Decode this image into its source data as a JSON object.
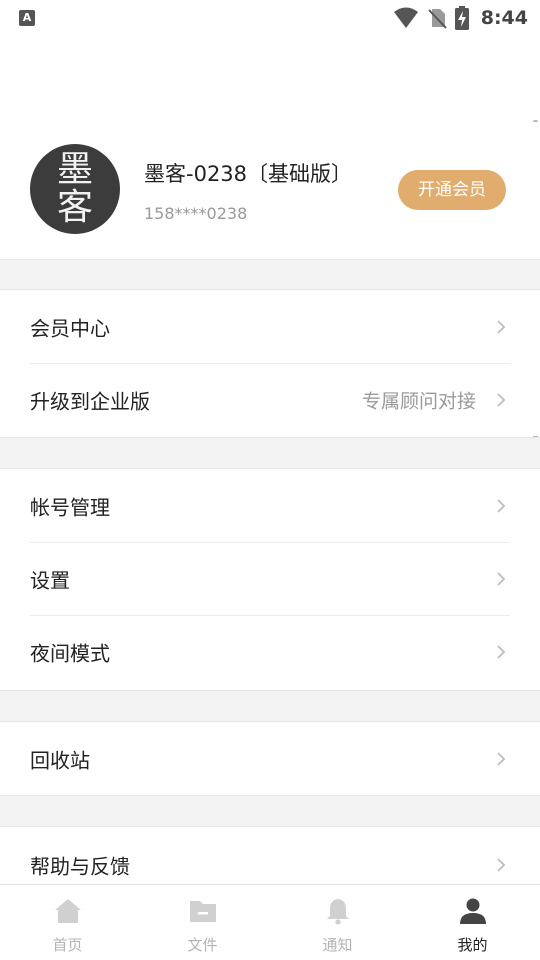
{
  "status_bar": {
    "app_icon_letter": "A",
    "time": "8:44"
  },
  "profile": {
    "avatar_chars": [
      "墨",
      "客"
    ],
    "name": "墨客-0238〔基础版〕",
    "phone": "158****0238",
    "member_button_label": "开通会员",
    "accent_color": "#e0ad6e"
  },
  "menu_groups": [
    [
      {
        "label": "会员中心",
        "value": ""
      },
      {
        "label": "升级到企业版",
        "value": "专属顾问对接"
      }
    ],
    [
      {
        "label": "帐号管理",
        "value": ""
      },
      {
        "label": "设置",
        "value": ""
      },
      {
        "label": "夜间模式",
        "value": ""
      }
    ],
    [
      {
        "label": "回收站",
        "value": ""
      }
    ],
    [
      {
        "label": "帮助与反馈",
        "value": ""
      }
    ]
  ],
  "tab_bar": {
    "tabs": [
      {
        "label": "首页",
        "icon": "home-icon"
      },
      {
        "label": "文件",
        "icon": "folder-icon"
      },
      {
        "label": "通知",
        "icon": "bell-icon"
      },
      {
        "label": "我的",
        "icon": "person-icon"
      }
    ],
    "active_index": 3
  }
}
